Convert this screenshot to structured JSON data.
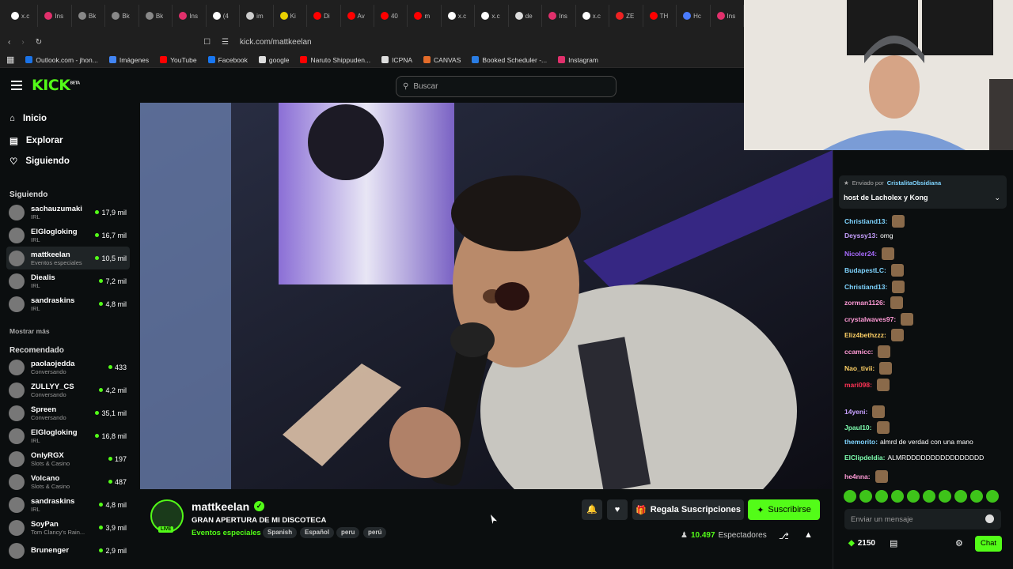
{
  "browser": {
    "tabs": [
      {
        "label": "x.c",
        "color": "#ffffff"
      },
      {
        "label": "Ins",
        "color": "#e1306c"
      },
      {
        "label": "Bk",
        "color": "#888888"
      },
      {
        "label": "Bk",
        "color": "#888888"
      },
      {
        "label": "Bk",
        "color": "#888888"
      },
      {
        "label": "Ins",
        "color": "#e1306c"
      },
      {
        "label": "(4",
        "color": "#ffffff"
      },
      {
        "label": "im",
        "color": "#cccccc"
      },
      {
        "label": "Ki",
        "color": "#e9d000"
      },
      {
        "label": "Di",
        "color": "#ff0000"
      },
      {
        "label": "Av",
        "color": "#ff0000"
      },
      {
        "label": "40",
        "color": "#ff0000"
      },
      {
        "label": "m",
        "color": "#ff0000"
      },
      {
        "label": "x.c",
        "color": "#ffffff"
      },
      {
        "label": "x.c",
        "color": "#ffffff"
      },
      {
        "label": "de",
        "color": "#dddddd"
      },
      {
        "label": "Ins",
        "color": "#e1306c"
      },
      {
        "label": "x.c",
        "color": "#ffffff"
      },
      {
        "label": "ZE",
        "color": "#e22"
      },
      {
        "label": "TH",
        "color": "#ff0000"
      },
      {
        "label": "Hc",
        "color": "#4a7cff"
      },
      {
        "label": "Ins",
        "color": "#e1306c"
      }
    ],
    "url": "kick.com/mattkeelan",
    "bookmarks": [
      {
        "label": "Outlook.com - jhon...",
        "color": "#1a73e8"
      },
      {
        "label": "Imágenes",
        "color": "#4285f4"
      },
      {
        "label": "YouTube",
        "color": "#ff0000"
      },
      {
        "label": "Facebook",
        "color": "#1877f2"
      },
      {
        "label": "google",
        "color": "#dddddd"
      },
      {
        "label": "Naruto Shippuden...",
        "color": "#ff0000"
      },
      {
        "label": "ICPNA",
        "color": "#dddddd"
      },
      {
        "label": "CANVAS",
        "color": "#e46c2a"
      },
      {
        "label": "Booked Scheduler -...",
        "color": "#2a7de4"
      },
      {
        "label": "Instagram",
        "color": "#e1306c"
      }
    ]
  },
  "header": {
    "logo": "KICK",
    "logo_sup": "BETA",
    "search_placeholder": "Buscar"
  },
  "sidebar": {
    "nav": [
      {
        "label": "Inicio",
        "icon": "home-icon"
      },
      {
        "label": "Explorar",
        "icon": "browse-icon"
      },
      {
        "label": "Siguiendo",
        "icon": "heart-icon"
      }
    ],
    "following_title": "Siguiendo",
    "following": [
      {
        "name": "sachauzumaki",
        "category": "IRL",
        "viewers": "17,9 mil"
      },
      {
        "name": "ElGlogloking",
        "category": "IRL",
        "viewers": "16,7 mil"
      },
      {
        "name": "mattkeelan",
        "category": "Eventos especiales",
        "viewers": "10,5 mil"
      },
      {
        "name": "Diealis",
        "category": "IRL",
        "viewers": "7,2 mil"
      },
      {
        "name": "sandraskins",
        "category": "IRL",
        "viewers": "4,8 mil"
      }
    ],
    "show_more": "Mostrar más",
    "recommended_title": "Recomendado",
    "recommended": [
      {
        "name": "paolaojedda",
        "category": "Conversando",
        "viewers": "433"
      },
      {
        "name": "ZULLYY_CS",
        "category": "Conversando",
        "viewers": "4,2 mil"
      },
      {
        "name": "Spreen",
        "category": "Conversando",
        "viewers": "35,1 mil"
      },
      {
        "name": "ElGlogloking",
        "category": "IRL",
        "viewers": "16,8 mil"
      },
      {
        "name": "OnlyRGX",
        "category": "Slots & Casino",
        "viewers": "197"
      },
      {
        "name": "Volcano",
        "category": "Slots & Casino",
        "viewers": "487"
      },
      {
        "name": "sandraskins",
        "category": "IRL",
        "viewers": "4,8 mil"
      },
      {
        "name": "SoyPan",
        "category": "Tom Clancy's Rain...",
        "viewers": "3,9 mil"
      },
      {
        "name": "Brunenger",
        "category": "",
        "viewers": "2,9 mil"
      }
    ]
  },
  "stream": {
    "live": "LIVE",
    "streamer": "mattkeelan",
    "title": "GRAN APERTURA DE MI DISCOTECA",
    "category": "Eventos especiales",
    "tags": [
      "Spanish",
      "Español",
      "peru",
      "perú"
    ],
    "gift_label": "Regala Suscripciones",
    "subscribe_label": "Suscribirse",
    "viewers_count": "10.497",
    "viewers_label": "Espectadores"
  },
  "chat": {
    "pinned_by_label": "Enviado por",
    "pinned_by_user": "CristalitaObsidiana",
    "pinned_text": "host de Lacholex y Kong",
    "messages": [
      {
        "user": "Christiand13:",
        "text": "",
        "color": "#7fd4ff"
      },
      {
        "user": "Deyssy13:",
        "text": "omg",
        "color": "#c7a0ff"
      },
      {
        "user": "Nicoler24:",
        "text": "",
        "color": "#a86bff"
      },
      {
        "user": "BudapestLC:",
        "text": "",
        "color": "#7fd4ff"
      },
      {
        "user": "Christiand13:",
        "text": "",
        "color": "#7fd4ff"
      },
      {
        "user": "zorman1126:",
        "text": "",
        "color": "#ff9ad6"
      },
      {
        "user": "crystalwaves97:",
        "text": "",
        "color": "#ff9ad6"
      },
      {
        "user": "Eliz4bethzzz:",
        "text": "",
        "color": "#ffd166"
      },
      {
        "user": "ccamicc:",
        "text": "",
        "color": "#ff9ad6"
      },
      {
        "user": "Nao_tivii:",
        "text": "",
        "color": "#ffd166"
      },
      {
        "user": "mari098:",
        "text": "",
        "color": "#ff3355"
      },
      {
        "user": "14yeni:",
        "text": "",
        "color": "#c7a0ff"
      },
      {
        "user": "Jpaul10:",
        "text": "",
        "color": "#7fffb0"
      },
      {
        "user": "themorito:",
        "text": "almrd de verdad con una mano",
        "color": "#7fd4ff"
      },
      {
        "user": "ElClipdeldia:",
        "text": "ALMRDDDDDDDDDDDDDDDD",
        "color": "#7fffb0"
      },
      {
        "user": "he4nna:",
        "text": "",
        "color": "#ff9ad6"
      }
    ],
    "input_placeholder": "Enviar un mensaje",
    "points": "2150",
    "chat_button": "Chat"
  },
  "colors": {
    "brand": "#53fc18",
    "bg": "#0b0e0f"
  }
}
